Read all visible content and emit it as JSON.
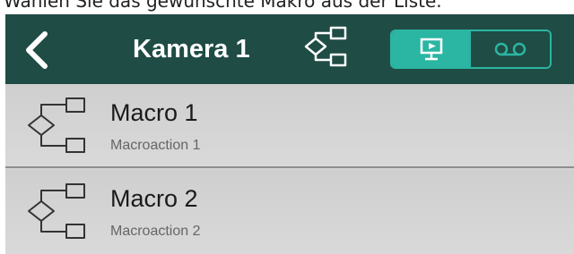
{
  "caption": "Wählen Sie das gewünschte Makro aus der Liste.",
  "navbar": {
    "title": "Kamera 1",
    "icons": [
      "back-chevron",
      "macro",
      "monitor-live",
      "archive-tape"
    ]
  },
  "macros": [
    {
      "title": "Macro 1",
      "subtitle": "Macroaction 1"
    },
    {
      "title": "Macro 2",
      "subtitle": "Macroaction 2"
    }
  ],
  "colors": {
    "navbar": "#1f4c44",
    "accent": "#2bb5a3",
    "list_background": "#d3d3d3"
  }
}
